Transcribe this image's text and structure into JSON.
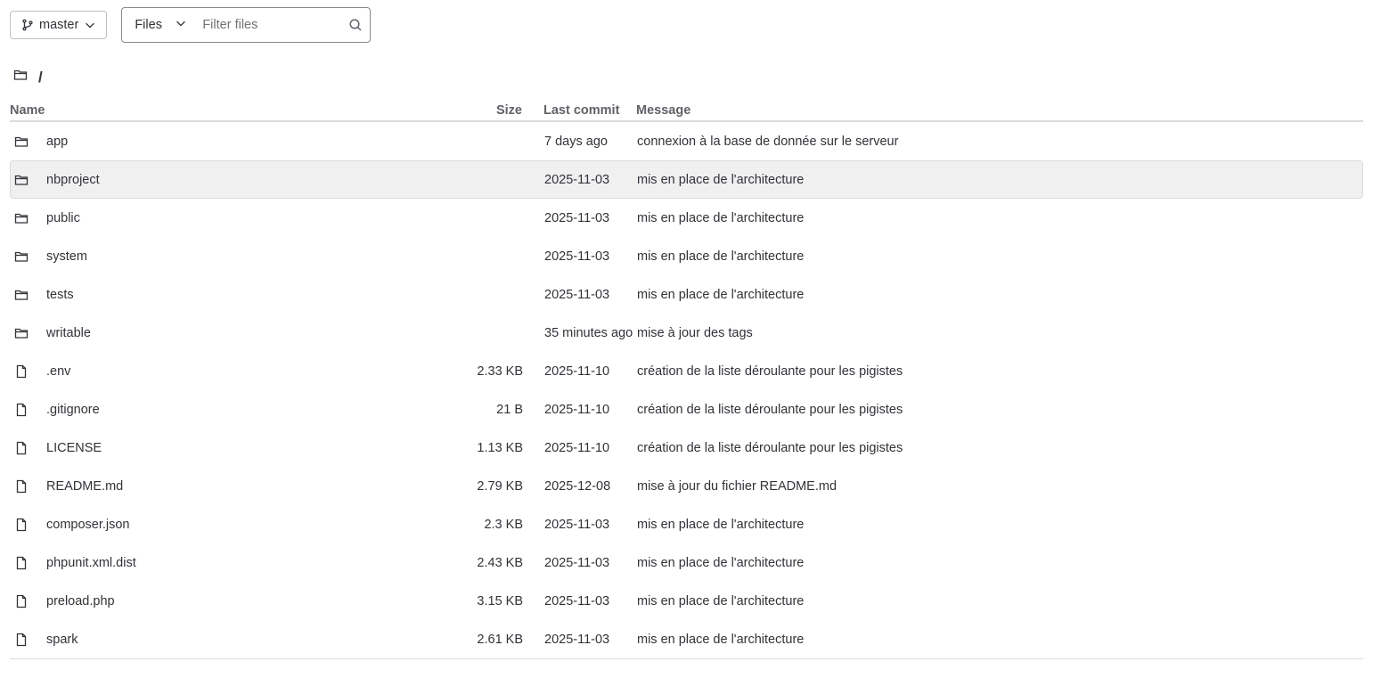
{
  "toolbar": {
    "branch_label": "master",
    "scope_label": "Files",
    "filter_placeholder": "Filter files",
    "filter_value": ""
  },
  "path": {
    "label": "/"
  },
  "table": {
    "headers": {
      "name": "Name",
      "size": "Size",
      "last_commit": "Last commit",
      "message": "Message"
    },
    "rows": [
      {
        "icon": "folder-icon",
        "name": "app",
        "size": "",
        "last_commit": "7 days ago",
        "message": "connexion à la base de donnée sur le serveur"
      },
      {
        "icon": "folder-icon",
        "name": "nbproject",
        "size": "",
        "last_commit": "2025-11-03",
        "message": "mis en place de l'architecture"
      },
      {
        "icon": "folder-icon",
        "name": "public",
        "size": "",
        "last_commit": "2025-11-03",
        "message": "mis en place de l'architecture"
      },
      {
        "icon": "folder-icon",
        "name": "system",
        "size": "",
        "last_commit": "2025-11-03",
        "message": "mis en place de l'architecture"
      },
      {
        "icon": "folder-icon",
        "name": "tests",
        "size": "",
        "last_commit": "2025-11-03",
        "message": "mis en place de l'architecture"
      },
      {
        "icon": "folder-icon",
        "name": "writable",
        "size": "",
        "last_commit": "35 minutes ago",
        "message": "mise à jour des tags"
      },
      {
        "icon": "file-icon",
        "name": ".env",
        "size": "2.33 KB",
        "last_commit": "2025-11-10",
        "message": "création de la liste déroulante pour les pigistes"
      },
      {
        "icon": "file-icon",
        "name": ".gitignore",
        "size": "21 B",
        "last_commit": "2025-11-10",
        "message": "création de la liste déroulante pour les pigistes"
      },
      {
        "icon": "file-icon",
        "name": "LICENSE",
        "size": "1.13 KB",
        "last_commit": "2025-11-10",
        "message": "création de la liste déroulante pour les pigistes"
      },
      {
        "icon": "file-icon",
        "name": "README.md",
        "size": "2.79 KB",
        "last_commit": "2025-12-08",
        "message": "mise à jour du fichier README.md"
      },
      {
        "icon": "file-icon",
        "name": "composer.json",
        "size": "2.3 KB",
        "last_commit": "2025-11-03",
        "message": "mis en place de l'architecture"
      },
      {
        "icon": "file-icon",
        "name": "phpunit.xml.dist",
        "size": "2.43 KB",
        "last_commit": "2025-11-03",
        "message": "mis en place de l'architecture"
      },
      {
        "icon": "file-icon",
        "name": "preload.php",
        "size": "3.15 KB",
        "last_commit": "2025-11-03",
        "message": "mis en place de l'architecture"
      },
      {
        "icon": "file-icon",
        "name": "spark",
        "size": "2.61 KB",
        "last_commit": "2025-11-03",
        "message": "mis en place de l'architecture"
      }
    ],
    "hovered_row": 1
  },
  "colors": {
    "text": "#333238",
    "muted": "#626168",
    "border": "#dcdcde",
    "hover_bg": "#f0f0f1"
  }
}
